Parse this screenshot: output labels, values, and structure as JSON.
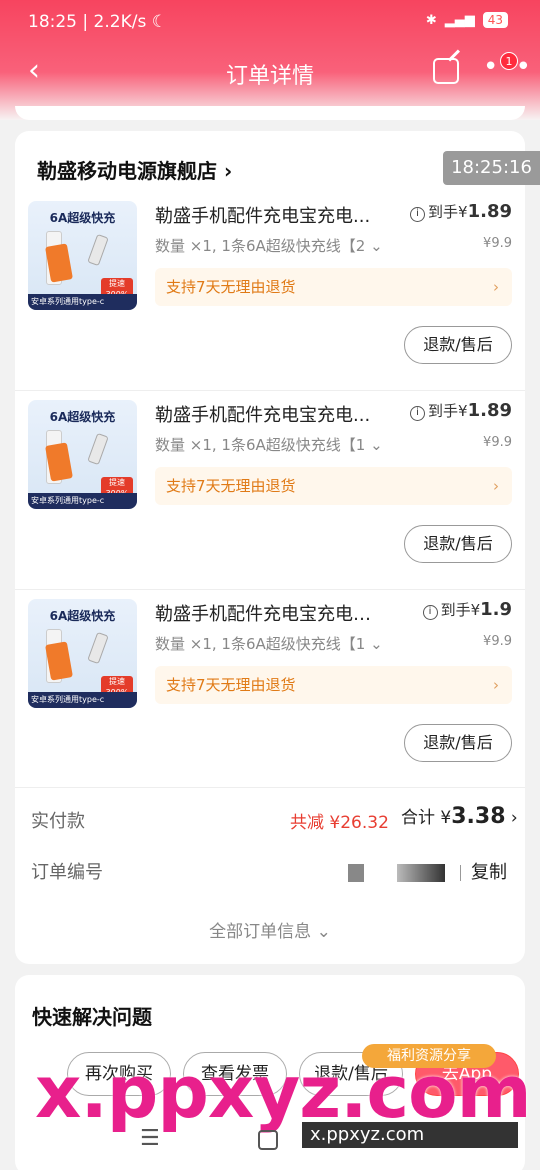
{
  "status_bar": {
    "time": "18:25",
    "net_speed": "2.2K/s",
    "battery": "43"
  },
  "nav": {
    "title": "订单详情",
    "back_glyph": "‹",
    "more_glyph": "•••",
    "badge_count": "1"
  },
  "timer": "18:25:16",
  "shop": {
    "name": "勒盛移动电源旗舰店 ›"
  },
  "items": [
    {
      "name": "勒盛手机配件充电宝充电...",
      "spec": "数量 ×1, 1条6A超级快充线【2",
      "price_prefix": "到手¥",
      "price": "1.89",
      "original_price": "¥9.9",
      "return_policy": "支持7天无理由退货",
      "refund_label": "退款/售后",
      "thumb_title": "6A超级快充",
      "thumb_bar": "安卓系列通用type-c",
      "thumb_tag": "提速 300%"
    },
    {
      "name": "勒盛手机配件充电宝充电...",
      "spec": "数量 ×1, 1条6A超级快充线【1",
      "price_prefix": "到手¥",
      "price": "1.89",
      "original_price": "¥9.9",
      "return_policy": "支持7天无理由退货",
      "refund_label": "退款/售后",
      "thumb_title": "6A超级快充",
      "thumb_bar": "安卓系列通用type-c",
      "thumb_tag": "提速 300%"
    },
    {
      "name": "勒盛手机配件充电宝充电线...",
      "spec": "数量 ×1, 1条6A超级快充线【1",
      "price_prefix": "到手¥",
      "price": "1.9",
      "original_price": "¥9.9",
      "return_policy": "支持7天无理由退货",
      "refund_label": "退款/售后",
      "thumb_title": "6A超级快充",
      "thumb_bar": "安卓系列通用type-c",
      "thumb_tag": "提速 300%"
    }
  ],
  "summary": {
    "paid_label": "实付款",
    "discount": "共减 ¥26.32",
    "total_prefix": "合计 ¥",
    "total_value": "3.38",
    "order_no_label": "订单编号",
    "copy_label": "复制",
    "all_info_label": "全部订单信息 ⌄"
  },
  "quick": {
    "title": "快速解决问题",
    "buttons": [
      "再次购买",
      "查看发票",
      "退款/售后",
      "去App"
    ]
  },
  "watermark": {
    "text": "x.ppxyz.com",
    "badge": "福利资源分享",
    "url": "x.ppxyz.com"
  }
}
